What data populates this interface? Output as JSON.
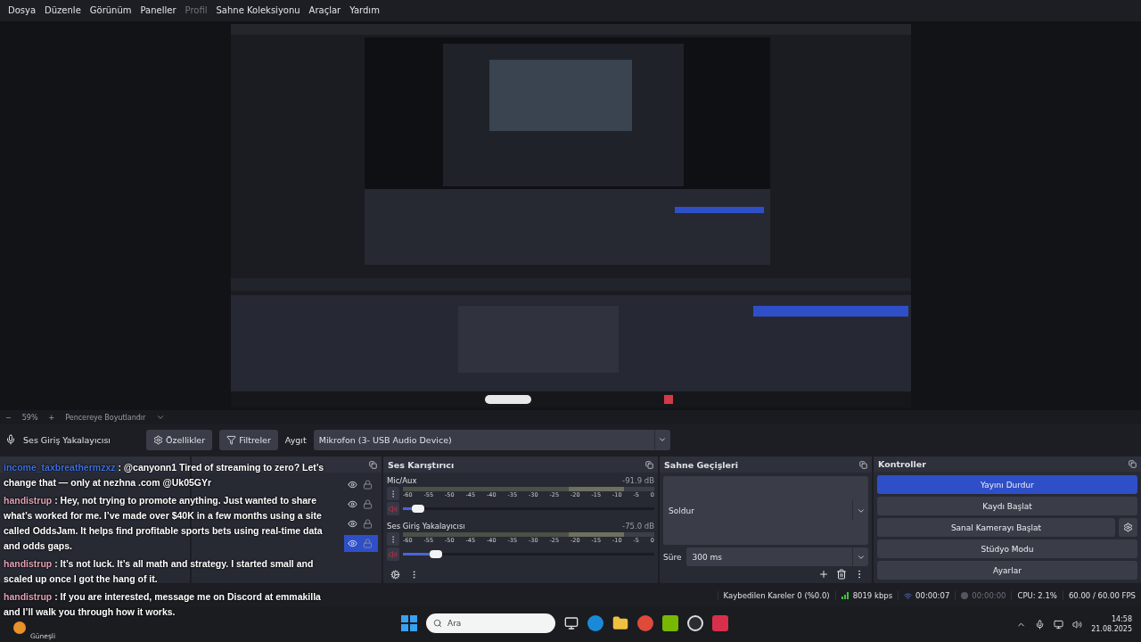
{
  "menu": [
    {
      "label": "Dosya",
      "disabled": false
    },
    {
      "label": "Düzenle",
      "disabled": false
    },
    {
      "label": "Görünüm",
      "disabled": false
    },
    {
      "label": "Paneller",
      "disabled": false
    },
    {
      "label": "Profil",
      "disabled": true
    },
    {
      "label": "Sahne Koleksiyonu",
      "disabled": false
    },
    {
      "label": "Araçlar",
      "disabled": false
    },
    {
      "label": "Yardım",
      "disabled": false
    }
  ],
  "zoom_bar": {
    "minus": "−",
    "zoom": "59%",
    "plus": "+",
    "fit": "Pencereye Boyutlandır"
  },
  "context_bar": {
    "source": "Ses Giriş Yakalayıcısı",
    "properties": "Özellikler",
    "filters": "Filtreler",
    "device_label": "Aygıt",
    "device": "Mikrofon (3- USB Audio Device)"
  },
  "sources": {
    "rows": [
      {
        "selected": false
      },
      {
        "selected": false
      },
      {
        "selected": false
      },
      {
        "selected": true
      }
    ]
  },
  "mixer": {
    "title": "Ses Karıştırıcı",
    "channels": [
      {
        "name": "Mic/Aux",
        "reading": "-91.9 dB",
        "muted": true,
        "level": 0.06,
        "scale": [
          "-60",
          "-55",
          "-50",
          "-45",
          "-40",
          "-35",
          "-30",
          "-25",
          "-20",
          "-15",
          "-10",
          "-5",
          "0"
        ]
      },
      {
        "name": "Ses Giriş Yakalayıcısı",
        "reading": "-75.0 dB",
        "muted": true,
        "level": 0.13,
        "scale": [
          "-60",
          "-55",
          "-50",
          "-45",
          "-40",
          "-35",
          "-30",
          "-25",
          "-20",
          "-15",
          "-10",
          "-5",
          "0"
        ]
      }
    ]
  },
  "transitions": {
    "title": "Sahne Geçişleri",
    "type": "Soldur",
    "duration_label": "Süre",
    "duration": "300 ms"
  },
  "controls": {
    "title": "Kontroller",
    "buttons": [
      {
        "label": "Yayını Durdur",
        "active": true,
        "settings": false
      },
      {
        "label": "Kaydı Başlat",
        "active": false,
        "settings": false
      },
      {
        "label": "Sanal Kamerayı Başlat",
        "active": false,
        "settings": true
      },
      {
        "label": "Stüdyo Modu",
        "active": false,
        "settings": false
      },
      {
        "label": "Ayarlar",
        "active": false,
        "settings": false
      }
    ]
  },
  "status_bar": {
    "dropped": "Kaybedilen Kareler 0 (%0.0)",
    "bitrate": "8019 kbps",
    "stream_time": "00:00:07",
    "record_time": "00:00:00",
    "cpu": "CPU: 2.1%",
    "fps": "60.00 / 60.00 FPS"
  },
  "chat": [
    {
      "user": "income_taxbreathermzxz",
      "color": "#3f6fe0",
      "text": " : @canyonn1 Tired of streaming to zero? Let’s change that — only at nezhna .com @Uk05GYr"
    },
    {
      "user": "handistrup",
      "color": "#e0a0b4",
      "text": " : Hey, not trying to promote anything. Just wanted to share what’s worked for me. I’ve made over $40K in a few months using a site called OddsJam. It helps find profitable sports bets using real-time data and odds gaps."
    },
    {
      "user": "handistrup",
      "color": "#e0a0b4",
      "text": " : It’s not luck. It’s all math and strategy. I started small and scaled up once I got the hang of it."
    },
    {
      "user": "handistrup",
      "color": "#e0a0b4",
      "text": " : If you are interested, message me on Discord at emmakilla and I’ll walk you through how it works."
    }
  ],
  "taskbar": {
    "weather": "Güneşli",
    "search_placeholder": "Ara",
    "time": "14:58",
    "date": "21.08.2025"
  }
}
